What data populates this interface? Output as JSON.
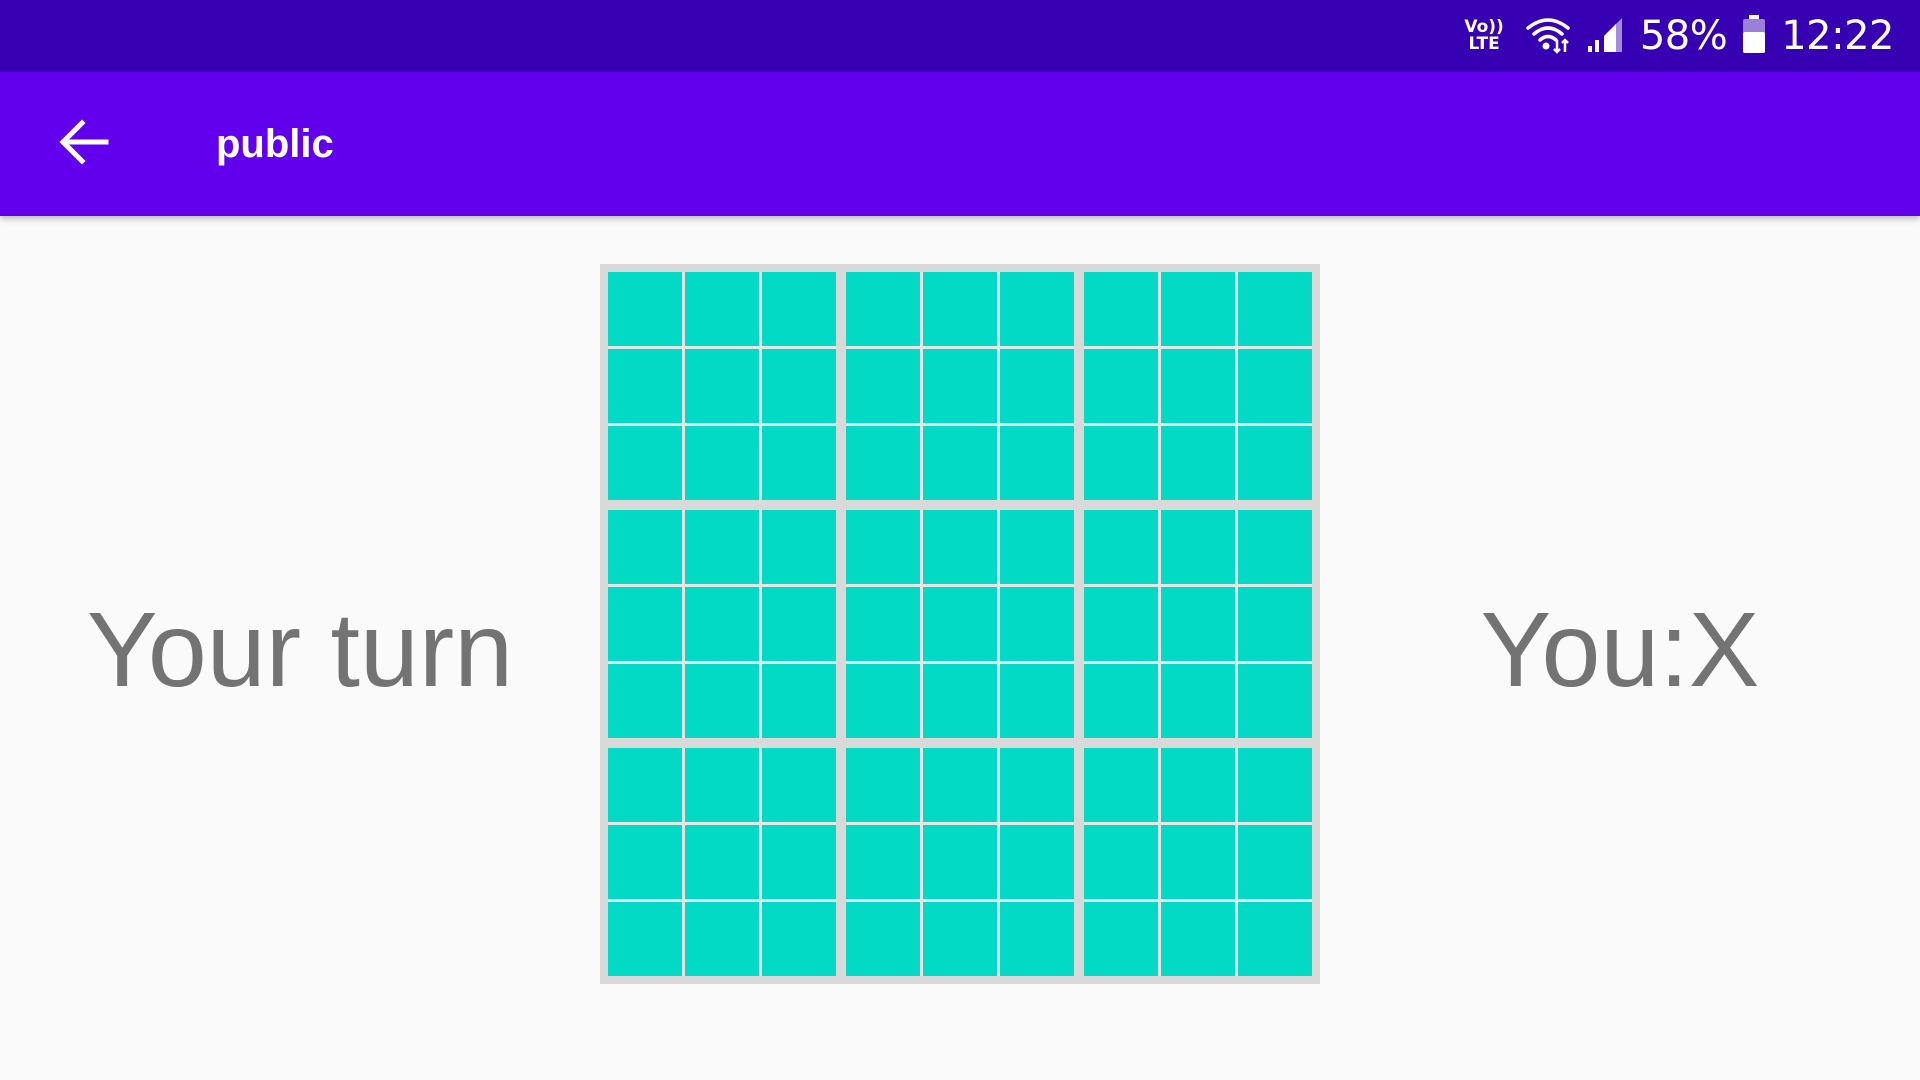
{
  "status_bar": {
    "volte_top": "Vo))",
    "volte_bottom": "LTE",
    "battery": "58%",
    "time": "12:22",
    "icons": [
      "volte-icon",
      "wifi-icon",
      "signal-icon",
      "battery-icon"
    ]
  },
  "app_bar": {
    "title": "public",
    "back_icon": "arrow-back-icon"
  },
  "game": {
    "turn_status": "Your turn",
    "player_symbol": "You:X",
    "board": {
      "blocks": 9,
      "cells_per_block": 9,
      "cell_color": "#03dac6",
      "grid_color": "#d9d9d9",
      "cells": [
        [
          "",
          "",
          "",
          "",
          "",
          "",
          "",
          "",
          ""
        ],
        [
          "",
          "",
          "",
          "",
          "",
          "",
          "",
          "",
          ""
        ],
        [
          "",
          "",
          "",
          "",
          "",
          "",
          "",
          "",
          ""
        ],
        [
          "",
          "",
          "",
          "",
          "",
          "",
          "",
          "",
          ""
        ],
        [
          "",
          "",
          "",
          "",
          "",
          "",
          "",
          "",
          ""
        ],
        [
          "",
          "",
          "",
          "",
          "",
          "",
          "",
          "",
          ""
        ],
        [
          "",
          "",
          "",
          "",
          "",
          "",
          "",
          "",
          ""
        ],
        [
          "",
          "",
          "",
          "",
          "",
          "",
          "",
          "",
          ""
        ],
        [
          "",
          "",
          "",
          "",
          "",
          "",
          "",
          "",
          ""
        ]
      ]
    }
  },
  "colors": {
    "status_bar": "#3700b3",
    "app_bar": "#6200ee",
    "background": "#fafafa",
    "text": "#737373"
  }
}
